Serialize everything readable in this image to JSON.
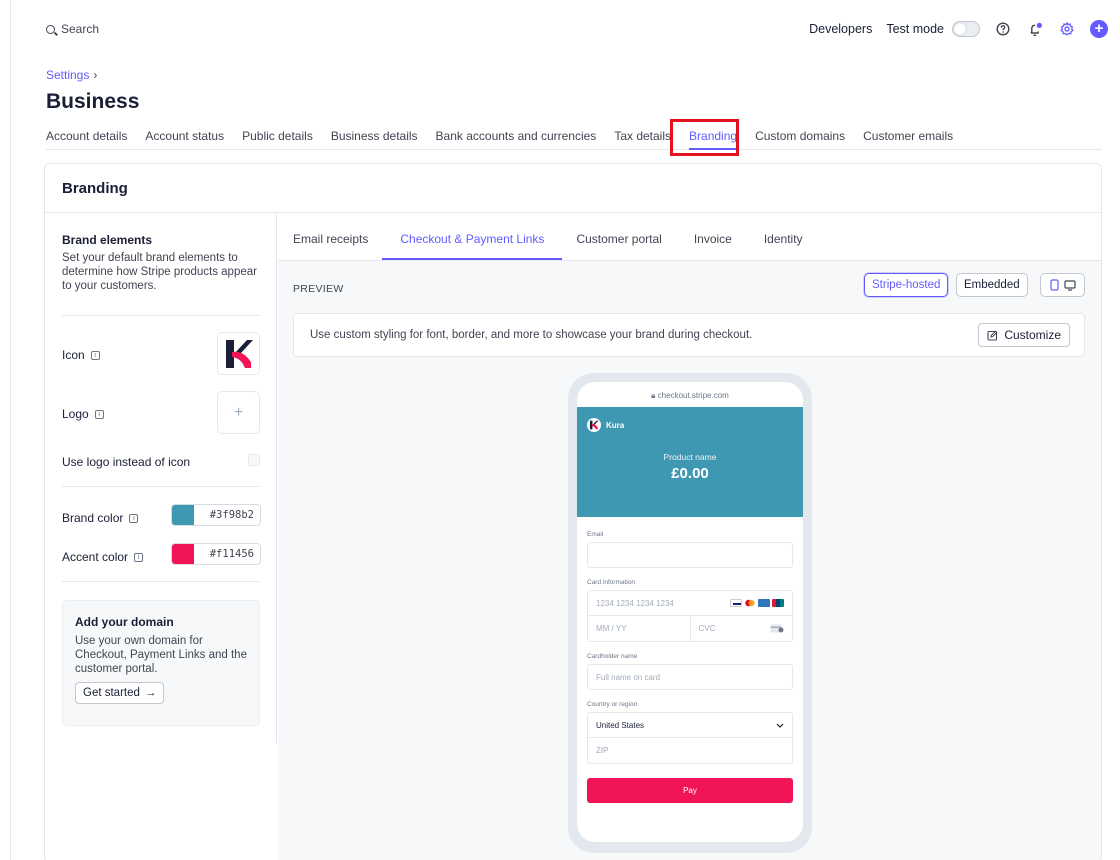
{
  "topbar": {
    "search_label": "Search",
    "developers": "Developers",
    "test_mode": "Test mode"
  },
  "breadcrumb": {
    "settings": "Settings",
    "separator": "›"
  },
  "page": {
    "title": "Business"
  },
  "tabs": [
    {
      "label": "Account details"
    },
    {
      "label": "Account status"
    },
    {
      "label": "Public details"
    },
    {
      "label": "Business details"
    },
    {
      "label": "Bank accounts and currencies"
    },
    {
      "label": "Tax details"
    },
    {
      "label": "Branding",
      "active": true
    },
    {
      "label": "Custom domains"
    },
    {
      "label": "Customer emails"
    }
  ],
  "card": {
    "title": "Branding"
  },
  "brand_elements": {
    "title": "Brand elements",
    "description": "Set your default brand elements to determine how Stripe products appear to your customers.",
    "icon_label": "Icon",
    "logo_label": "Logo",
    "logo_placeholder": "+",
    "use_logo_label": "Use logo instead of icon",
    "brand_color_label": "Brand color",
    "brand_color": "#3f98b2",
    "accent_color_label": "Accent color",
    "accent_color": "#f11456"
  },
  "domain_card": {
    "title": "Add your domain",
    "description": "Use your own domain for Checkout, Payment Links and the customer portal.",
    "button": "Get started",
    "button_arrow": "→"
  },
  "subtabs": [
    {
      "label": "Email receipts"
    },
    {
      "label": "Checkout & Payment Links",
      "active": true
    },
    {
      "label": "Customer portal"
    },
    {
      "label": "Invoice"
    },
    {
      "label": "Identity"
    }
  ],
  "preview": {
    "label": "PREVIEW",
    "stripe_hosted": "Stripe-hosted",
    "embedded": "Embedded",
    "banner_text": "Use custom styling for font, border, and more to showcase your brand during checkout.",
    "customize": "Customize"
  },
  "checkout": {
    "url": "checkout.stripe.com",
    "brand_name": "Kura",
    "product_name": "Product name",
    "price": "£0.00",
    "email_label": "Email",
    "card_label": "Card information",
    "card_placeholder": "1234 1234 1234 1234",
    "expiry_placeholder": "MM / YY",
    "cvc_placeholder": "CVC",
    "cardholder_label": "Cardholder name",
    "cardholder_placeholder": "Full name on card",
    "country_label": "Country or region",
    "country_value": "United States",
    "zip_placeholder": "ZIP",
    "pay": "Pay"
  },
  "colors": {
    "accent": "#635bff",
    "highlight": "#e0141e"
  }
}
